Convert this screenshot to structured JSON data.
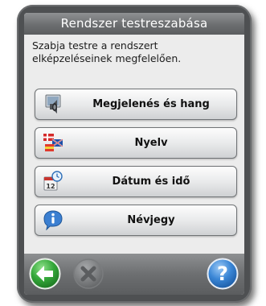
{
  "dialog": {
    "title": "Rendszer testreszabása",
    "description_line1": "Szabja testre a rendszert",
    "description_line2": "elképzeléseinek megfelelően."
  },
  "menu": [
    {
      "label": "Megjelenés és hang",
      "icon": "speaker-display-icon"
    },
    {
      "label": "Nyelv",
      "icon": "flags-icon"
    },
    {
      "label": "Dátum és idő",
      "icon": "calendar-clock-icon"
    },
    {
      "label": "Névjegy",
      "icon": "info-icon"
    }
  ],
  "bottom": {
    "back": {
      "icon": "back-arrow-icon",
      "color": "#2f9e2f",
      "enabled": true
    },
    "cancel": {
      "icon": "close-icon",
      "color": "#8a8c8e",
      "enabled": false
    },
    "help": {
      "icon": "help-icon",
      "color": "#2a78c8",
      "enabled": true
    }
  }
}
